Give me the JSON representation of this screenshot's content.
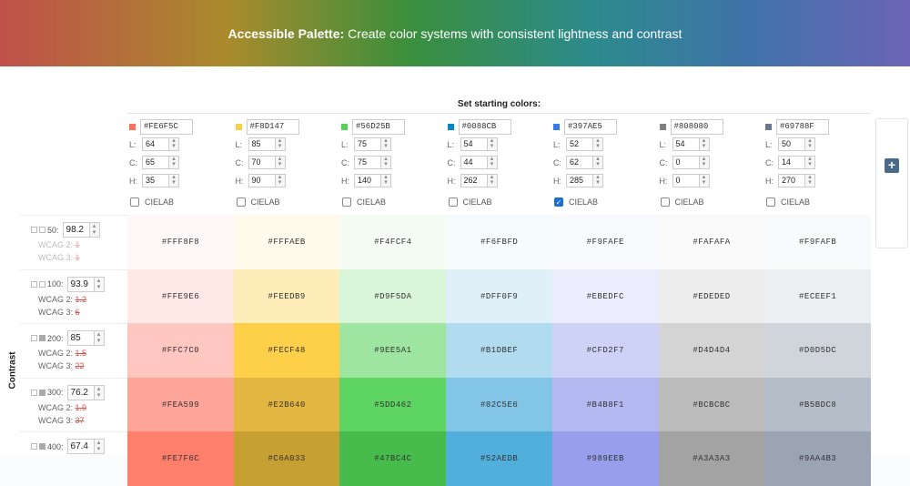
{
  "banner": {
    "title_bold": "Accessible Palette:",
    "title_rest": "Create color systems with consistent lightness and contrast"
  },
  "set_title": "Set starting colors:",
  "labels": {
    "L": "L:",
    "C": "C:",
    "H": "H:",
    "cielab": "CIELAB",
    "contrast": "Contrast"
  },
  "colors": [
    {
      "hex": "#FE6F5C",
      "L": "64",
      "C": "65",
      "H": "35",
      "cielab": false,
      "swatch": "#FE6F5C"
    },
    {
      "hex": "#F8D147",
      "L": "85",
      "C": "70",
      "H": "90",
      "cielab": false,
      "swatch": "#F8D147"
    },
    {
      "hex": "#56D25B",
      "L": "75",
      "C": "75",
      "H": "140",
      "cielab": false,
      "swatch": "#56D25B"
    },
    {
      "hex": "#0088CB",
      "L": "54",
      "C": "44",
      "H": "262",
      "cielab": false,
      "swatch": "#0088CB"
    },
    {
      "hex": "#397AE5",
      "L": "52",
      "C": "62",
      "H": "285",
      "cielab": true,
      "swatch": "#397AE5"
    },
    {
      "hex": "#808080",
      "L": "54",
      "C": "0",
      "H": "0",
      "cielab": false,
      "swatch": "#808080"
    },
    {
      "hex": "#69788F",
      "L": "50",
      "C": "14",
      "H": "270",
      "cielab": false,
      "swatch": "#69788F"
    }
  ],
  "rows": [
    {
      "name": "50:",
      "value": "98.2",
      "wcag2": "1",
      "wcag3": "1",
      "faded": true,
      "cells": [
        "#FFF8F8",
        "#FFFAEB",
        "#F4FCF4",
        "#F6FBFD",
        "#F9FAFE",
        "#FAFAFA",
        "#F9FAFB"
      ]
    },
    {
      "name": "100:",
      "value": "93.9",
      "wcag2": "1.2",
      "wcag3": "6",
      "faded": false,
      "cells": [
        "#FFE9E6",
        "#FEEDB9",
        "#D9F5DA",
        "#DFF0F9",
        "#EBEDFC",
        "#EDEDED",
        "#ECEEF1"
      ]
    },
    {
      "name": "200:",
      "value": "85",
      "wcag2": "1.5",
      "wcag3": "22",
      "faded": false,
      "cells": [
        "#FFC7C0",
        "#FECF48",
        "#9EE5A1",
        "#B1DBEF",
        "#CFD2F7",
        "#D4D4D4",
        "#D0D5DC"
      ]
    },
    {
      "name": "300:",
      "value": "76.2",
      "wcag2": "1.9",
      "wcag3": "37",
      "faded": false,
      "cells": [
        "#FEA599",
        "#E2B640",
        "#5DD462",
        "#82C5E6",
        "#B4B8F1",
        "#BCBCBC",
        "#B5BDC8"
      ]
    },
    {
      "name": "400:",
      "value": "67.4",
      "wcag2": "",
      "wcag3": "",
      "faded": false,
      "cells": [
        "#FE7F6C",
        "#C6A033",
        "#47BC4C",
        "#52AEDB",
        "#989EEB",
        "#A3A3A3",
        "#9AA4B3"
      ]
    }
  ],
  "wcag_labels": {
    "w2": "WCAG 2:",
    "w3": "WCAG 3:"
  }
}
